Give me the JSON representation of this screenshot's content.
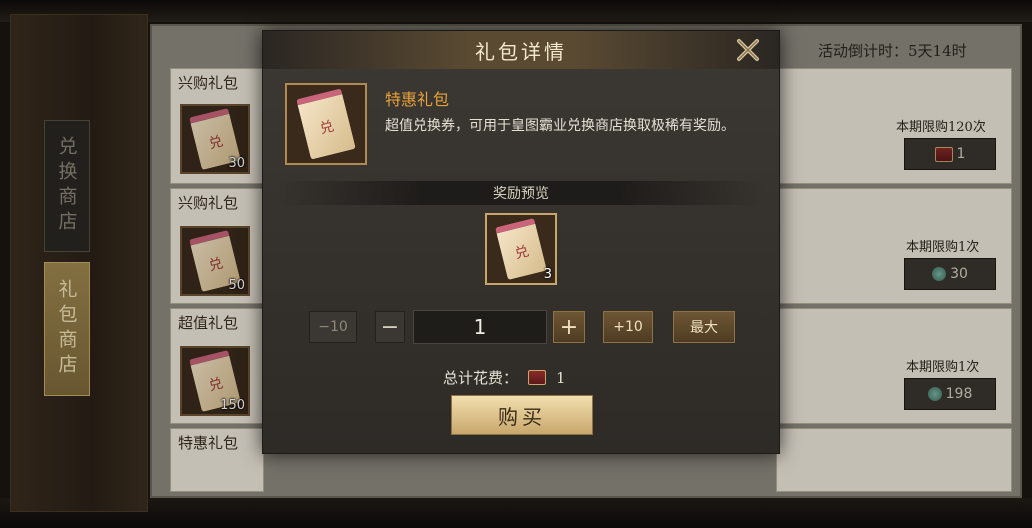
{
  "tabs": {
    "exchange_shop": "兑换商店",
    "gift_shop": "礼包商店"
  },
  "countdown": "活动倒计时：5天14时",
  "gift_list": [
    {
      "title": "兴购礼包",
      "count": "30",
      "limit": "本期限购120次",
      "price": "1",
      "currency_icon": "chest-icon"
    },
    {
      "title": "兴购礼包",
      "count": "50",
      "limit": "本期限购1次",
      "price": "30",
      "currency_icon": "jade-coin-icon"
    },
    {
      "title": "超值礼包",
      "count": "150",
      "limit": "本期限购1次",
      "price": "198",
      "currency_icon": "jade-coin-icon"
    },
    {
      "title": "特惠礼包"
    }
  ],
  "modal": {
    "title": "礼包详情",
    "gift_name": "特惠礼包",
    "gift_desc": "超值兑换券，可用于皇图霸业兑换商店换取极稀有奖励。",
    "ticket_glyph": "兑",
    "preview_label": "奖励预览",
    "reward_count": "3",
    "minus10_label": "−10",
    "minus_label": "−",
    "quantity": "1",
    "plus_label": "+",
    "plus10_label": "+10",
    "max_label": "最大",
    "total_label": "总计花费：",
    "total_cost": "1",
    "buy_label": "购买"
  },
  "colors": {
    "gift_name": "#e8a23a",
    "buy_button": "#e6cf98",
    "panel_bg": "#8e8a7f",
    "card_bg": "#f0eadd"
  }
}
